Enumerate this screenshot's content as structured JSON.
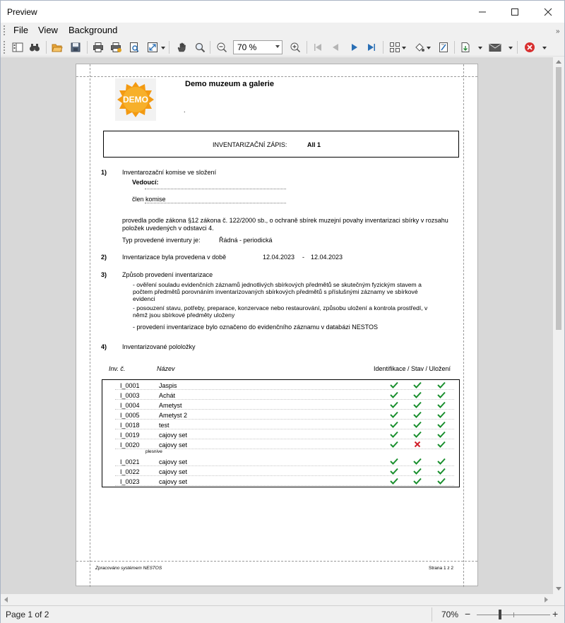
{
  "window": {
    "title": "Preview"
  },
  "menu": {
    "file": "File",
    "view": "View",
    "background": "Background"
  },
  "toolbar": {
    "zoom_value": "70 %"
  },
  "status": {
    "page_info": "Page 1 of 2",
    "zoom": "70%"
  },
  "report": {
    "org_name": "Demo muzeum a galerie",
    "org_dot": ".",
    "logo_text": "DEMO",
    "inv_title": "INVENTARIZAČNÍ ZÁPIS:",
    "inv_id": "All 1",
    "s1_num": "1)",
    "s1_title": "Inventarozační komise ve složení",
    "leader_label": "Vedoucí:",
    "member_label": "člen komise",
    "law_text_1": "provedla podle zákona §12 zákona č. 122/2000 sb., o ochraně sbírek muzejní povahy inventarizaci sbírky v rozsahu",
    "law_text_2": "položek uvedených v odstavci 4.",
    "type_label": "Typ provedené inventury je:",
    "type_value": "Řádná - periodická",
    "s2_num": "2)",
    "s2_title": "Inventarizace byla provedena v době",
    "date_from": "12.04.2023",
    "date_dash": "-",
    "date_to": "12.04.2023",
    "s3_num": "3)",
    "s3_title": "Způsob provedení inventarizace",
    "s3_b1_l1": "- ověření souladu evidenčních záznamů jednotlivých sbírkových předmětů se skutečným fyzickým stavem a",
    "s3_b1_l2": "počtem předmětů porovnáním inventarizovaných sbírkových předmětů s příslušnými záznamy ve sbírkové",
    "s3_b1_l3": "evidenci",
    "s3_b2_l1": "- posouzení stavu, potřeby, preparace, konzervace nebo restaurování, způsobu uložení a kontrola prostředí, v",
    "s3_b2_l2": "němž jsou sbírkové předměty uloženy",
    "s3_b3": "- provedení inventarizace bylo označeno do evidenčního záznamu v databázi NESTOS",
    "s4_num": "4)",
    "s4_title": "Inventarizované pololožky",
    "col_inv": "Inv. č.",
    "col_name": "Název",
    "col_status": "Identifikace / Stav / Uložení",
    "items": [
      {
        "inv": "I_0001",
        "name": "Jaspis",
        "checks": [
          true,
          true,
          true
        ]
      },
      {
        "inv": "I_0003",
        "name": "Achát",
        "checks": [
          true,
          true,
          true
        ]
      },
      {
        "inv": "I_0004",
        "name": "Ametyst",
        "checks": [
          true,
          true,
          true
        ]
      },
      {
        "inv": "I_0005",
        "name": "Ametyst 2",
        "checks": [
          true,
          true,
          true
        ]
      },
      {
        "inv": "I_0018",
        "name": "test",
        "checks": [
          true,
          true,
          true
        ]
      },
      {
        "inv": "I_0019",
        "name": "cajovy set",
        "checks": [
          true,
          true,
          true
        ]
      },
      {
        "inv": "I_0020",
        "name": "cajovy set",
        "checks": [
          true,
          false,
          true
        ],
        "note": "plesnive"
      },
      {
        "inv": "I_0021",
        "name": "cajovy set",
        "checks": [
          true,
          true,
          true
        ]
      },
      {
        "inv": "I_0022",
        "name": "cajovy set",
        "checks": [
          true,
          true,
          true
        ]
      },
      {
        "inv": "I_0023",
        "name": "cajovy set",
        "checks": [
          true,
          true,
          true
        ]
      }
    ],
    "footer_left": "Zpracováno systémem NESTOS",
    "footer_right": "Strana 1 z 2"
  },
  "colors": {
    "check": "#1a8f2e",
    "cross": "#d0202a",
    "badge": "#f39a12",
    "close_icon": "#d83030"
  }
}
